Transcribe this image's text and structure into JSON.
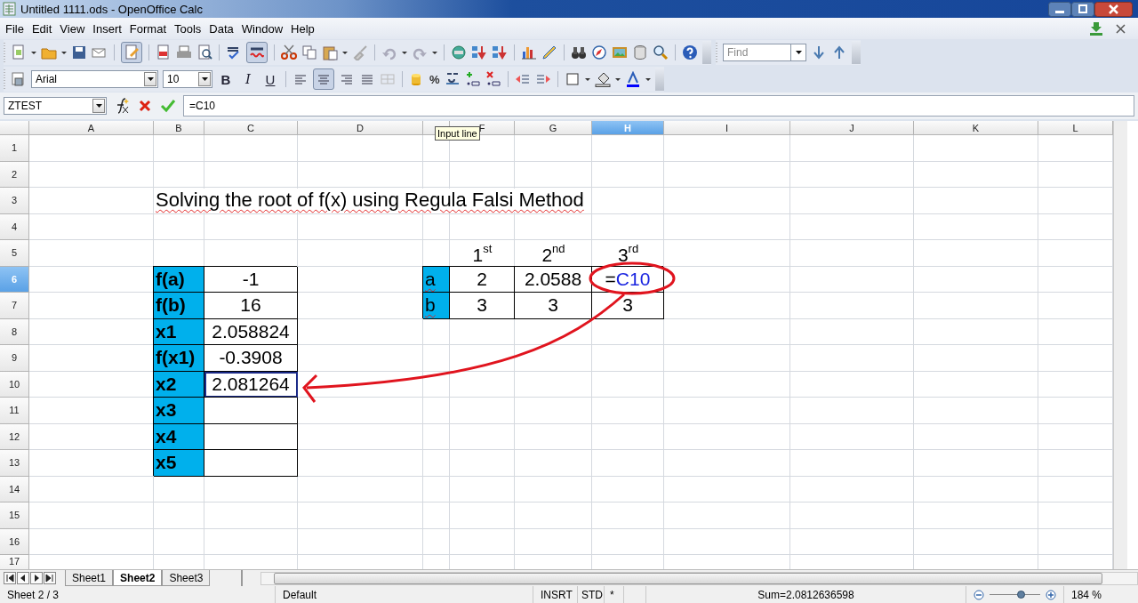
{
  "window": {
    "title": "Untitled 1111.ods - OpenOffice Calc"
  },
  "menu": [
    "File",
    "Edit",
    "View",
    "Insert",
    "Format",
    "Tools",
    "Data",
    "Window",
    "Help"
  ],
  "standard_toolbar": {
    "edit_file_on": true,
    "autospell_on": true
  },
  "find_toolbar": {
    "placeholder": "Find"
  },
  "formatting_toolbar": {
    "font_name": "Arial",
    "font_size": "10",
    "bold": "B",
    "italic": "I",
    "underline": "U",
    "percent": "%",
    "align_center_on": true
  },
  "formula_bar": {
    "name_box": "ZTEST",
    "input": "=C10"
  },
  "tooltip": "Input line",
  "columns": [
    {
      "label": "A",
      "selected": false
    },
    {
      "label": "B",
      "selected": false
    },
    {
      "label": "C",
      "selected": false
    },
    {
      "label": "D",
      "selected": false
    },
    {
      "selected": false
    },
    {
      "label": "F",
      "selected": false
    },
    {
      "label": "G",
      "selected": false
    },
    {
      "label": "H",
      "selected": true
    },
    {
      "label": "I",
      "selected": false
    },
    {
      "label": "J",
      "selected": false
    },
    {
      "label": "K",
      "selected": false
    },
    {
      "label": "L",
      "selected": false
    }
  ],
  "rows": [
    {
      "header": "1",
      "selected": false
    },
    {
      "header": "2",
      "selected": false
    },
    {
      "header": "3",
      "selected": false,
      "cells": [
        {
          "kind": "empty"
        },
        {
          "kind": "title",
          "text": "Solving the root of f(x) using Regula Falsi Method",
          "spell_error": true,
          "highlighted": false
        }
      ]
    },
    {
      "header": "4",
      "selected": false
    },
    {
      "header": "5",
      "selected": false,
      "cells": [
        {
          "kind": "empty"
        },
        {
          "kind": "empty"
        },
        {
          "kind": "empty"
        },
        {
          "kind": "empty"
        },
        {
          "kind": "empty"
        },
        {
          "kind": "heading",
          "text": "1$^{st}$",
          "spell_error": false,
          "highlighted": false
        },
        {
          "kind": "heading",
          "text": "2$^{nd}$",
          "spell_error": false,
          "highlighted": false
        },
        {
          "kind": "heading",
          "text": "3$^{rd}$",
          "spell_error": false,
          "highlighted": false
        }
      ]
    },
    {
      "header": "6",
      "selected": true,
      "cells": [
        {
          "kind": "empty"
        },
        {
          "kind": "label",
          "text": "f(a)",
          "bold": true,
          "spell_error": false,
          "highlighted": false
        },
        {
          "kind": "value",
          "text": "-1",
          "spell_error": false,
          "highlighted": false
        },
        {
          "kind": "empty"
        },
        {
          "kind": "label",
          "text": "a",
          "bold": false,
          "spell_error": true,
          "highlighted": false
        },
        {
          "kind": "value",
          "text": "2",
          "spell_error": false,
          "highlighted": false
        },
        {
          "kind": "value",
          "text": "2.0588",
          "spell_error": false,
          "highlighted": false
        },
        {
          "kind": "formula",
          "text": "=",
          "reference": "C10",
          "spell_error": false,
          "highlighted": false
        }
      ]
    },
    {
      "header": "7",
      "selected": false,
      "cells": [
        {
          "kind": "empty"
        },
        {
          "kind": "label",
          "text": "f(b)",
          "bold": true,
          "spell_error": false,
          "highlighted": false
        },
        {
          "kind": "value",
          "text": "16",
          "spell_error": false,
          "highlighted": false
        },
        {
          "kind": "empty"
        },
        {
          "kind": "label",
          "text": "b",
          "bold": false,
          "spell_error": true,
          "highlighted": false
        },
        {
          "kind": "value",
          "text": "3",
          "spell_error": false,
          "highlighted": false
        },
        {
          "kind": "value",
          "text": "3",
          "spell_error": false,
          "highlighted": false
        },
        {
          "kind": "value",
          "text": "3",
          "spell_error": false,
          "highlighted": false
        }
      ]
    },
    {
      "header": "8",
      "selected": false,
      "cells": [
        {
          "kind": "empty"
        },
        {
          "kind": "label",
          "text": "x1",
          "bold": true,
          "spell_error": false,
          "highlighted": false
        },
        {
          "kind": "value",
          "text": "2.058824",
          "spell_error": false,
          "highlighted": false
        }
      ]
    },
    {
      "header": "9",
      "selected": false,
      "cells": [
        {
          "kind": "empty"
        },
        {
          "kind": "label",
          "text": "f(x1)",
          "bold": true,
          "spell_error": false,
          "highlighted": false
        },
        {
          "kind": "value",
          "text": "-0.3908",
          "spell_error": false,
          "highlighted": false
        }
      ]
    },
    {
      "header": "10",
      "selected": false,
      "cells": [
        {
          "kind": "empty"
        },
        {
          "kind": "label",
          "text": "x2",
          "bold": true,
          "spell_error": false,
          "highlighted": false
        },
        {
          "kind": "value",
          "text": "2.081264",
          "spell_error": false,
          "highlighted": true
        }
      ]
    },
    {
      "header": "11",
      "selected": false,
      "cells": [
        {
          "kind": "empty"
        },
        {
          "kind": "label",
          "text": "x3",
          "bold": true,
          "spell_error": false,
          "highlighted": false
        },
        {
          "kind": "value",
          "highlighted": false
        }
      ]
    },
    {
      "header": "12",
      "selected": false,
      "cells": [
        {
          "kind": "empty"
        },
        {
          "kind": "label",
          "text": "x4",
          "bold": true,
          "spell_error": false,
          "highlighted": false
        },
        {
          "kind": "value",
          "highlighted": false
        }
      ]
    },
    {
      "header": "13",
      "selected": false,
      "cells": [
        {
          "kind": "empty"
        },
        {
          "kind": "label",
          "text": "x5",
          "bold": true,
          "spell_error": false,
          "highlighted": false
        },
        {
          "kind": "value",
          "highlighted": false
        }
      ]
    },
    {
      "header": "14",
      "selected": false
    },
    {
      "header": "15",
      "selected": false
    },
    {
      "header": "16",
      "selected": false
    },
    {
      "header": "17",
      "selected": false
    }
  ],
  "sheet_tabs": [
    {
      "label": "Sheet1",
      "selected": false
    },
    {
      "label": "Sheet2",
      "selected": true
    },
    {
      "label": "Sheet3",
      "selected": false
    }
  ],
  "status_bar": {
    "sheet": "Sheet 2 / 3",
    "page_style": "Default",
    "insert_mode": "INSRT",
    "selection_mode": "STD",
    "modified": "*",
    "sum": "Sum=2.0812636598",
    "zoom": {
      "level": 0.62
    },
    "zoom_percent": "184 %"
  }
}
